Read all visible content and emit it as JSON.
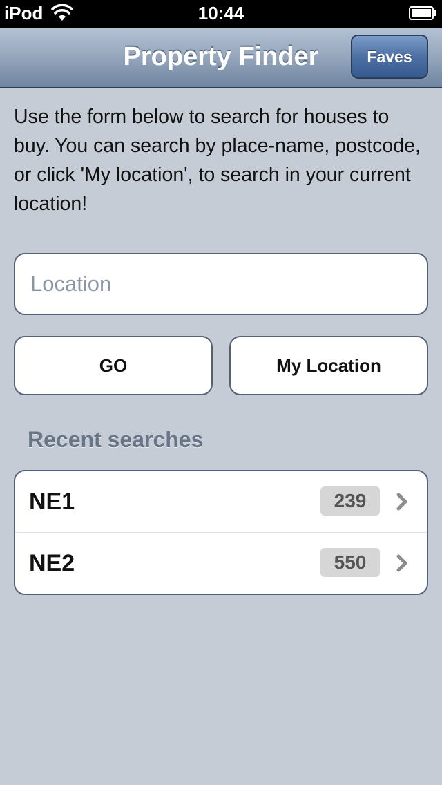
{
  "status_bar": {
    "carrier": "iPod",
    "time": "10:44",
    "icons": [
      "wifi-icon",
      "battery-icon"
    ]
  },
  "nav_bar": {
    "title": "Property Finder",
    "faves_label": "Faves"
  },
  "intro": {
    "text": "Use the form below to search for houses to buy. You can search by place-name, postcode, or click 'My location', to search in your current location!"
  },
  "search": {
    "value": "",
    "placeholder": "Location"
  },
  "buttons": {
    "go_label": "GO",
    "my_location_label": "My Location"
  },
  "recent": {
    "header": "Recent searches",
    "items": [
      {
        "label": "NE1",
        "count": "239"
      },
      {
        "label": "NE2",
        "count": "550"
      }
    ]
  },
  "colors": {
    "background": "#c5ccd6",
    "nav_top": "#b4c2d4",
    "nav_bottom": "#6f84a0",
    "faves_button": "#4d70a4",
    "border": "#536179",
    "section_header": "#677587",
    "badge": "#d6d6d6"
  }
}
